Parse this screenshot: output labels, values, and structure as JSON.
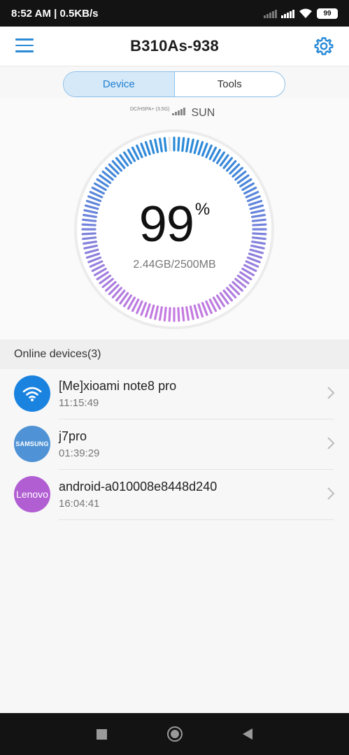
{
  "status_bar": {
    "time": "8:52 AM | 0.5KB/s",
    "battery": "99"
  },
  "header": {
    "title": "B310As-938",
    "menu_icon": "menu-icon",
    "settings_icon": "gear-icon"
  },
  "tabs": [
    {
      "label": "Device",
      "active": true
    },
    {
      "label": "Tools",
      "active": false
    }
  ],
  "network": {
    "technology": "DC/HSPA+ (3.5G)",
    "operator": "SUN"
  },
  "usage": {
    "percent": "99",
    "percent_symbol": "%",
    "text": "2.44GB/2500MB",
    "fraction": 0.99
  },
  "online_devices": {
    "header": "Online devices(3)",
    "items": [
      {
        "name": "[Me]xioami note8 pro",
        "time": "11:15:49",
        "avatar": "wifi-icon",
        "avatar_label": ""
      },
      {
        "name": "j7pro",
        "time": "01:39:29",
        "avatar": "samsung-logo",
        "avatar_label": "SAMSUNG"
      },
      {
        "name": "android-a010008e8448d240",
        "time": "16:04:41",
        "avatar": "lenovo-logo",
        "avatar_label": "Lenovo"
      }
    ]
  },
  "colors": {
    "accent": "#2b8bd6",
    "gauge_start": "#2a8ad8",
    "gauge_end": "#c57be0"
  },
  "nav": {
    "recents_icon": "square-icon",
    "home_icon": "circle-icon",
    "back_icon": "back-triangle-icon"
  }
}
